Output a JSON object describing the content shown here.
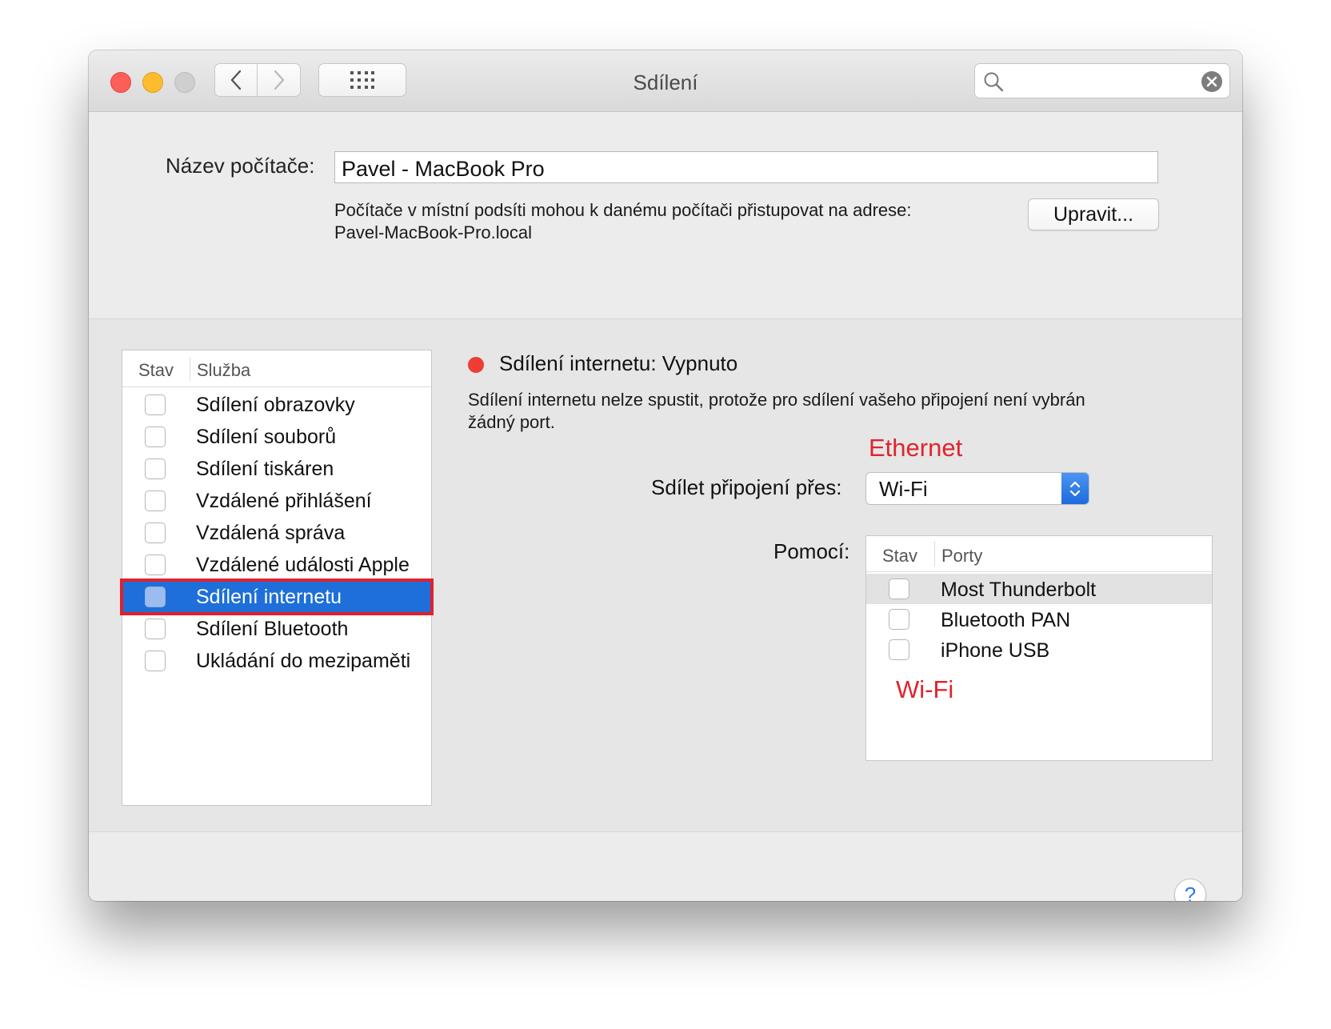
{
  "window": {
    "title": "Sdílení"
  },
  "toolbar": {
    "back_icon": "chevron-left-icon",
    "forward_icon": "chevron-right-icon",
    "grid_icon": "grid-icon"
  },
  "search": {
    "value": "",
    "placeholder": ""
  },
  "computer_name": {
    "label": "Název počítače:",
    "value": "Pavel - MacBook Pro",
    "address_line1": "Počítače v místní podsíti mohou k danému počítači přistupovat na adrese:",
    "address_line2": "Pavel-MacBook-Pro.local",
    "edit_button": "Upravit..."
  },
  "services": {
    "header_status": "Stav",
    "header_service": "Služba",
    "items": [
      {
        "label": "Sdílení obrazovky",
        "checked": false
      },
      {
        "label": "Sdílení souborů",
        "checked": false
      },
      {
        "label": "Sdílení tiskáren",
        "checked": false
      },
      {
        "label": "Vzdálené přihlášení",
        "checked": false
      },
      {
        "label": "Vzdálená správa",
        "checked": false
      },
      {
        "label": "Vzdálené události Apple",
        "checked": false
      },
      {
        "label": "Sdílení internetu",
        "checked": false,
        "selected": true
      },
      {
        "label": "Sdílení Bluetooth",
        "checked": false
      },
      {
        "label": "Ukládání do mezipaměti",
        "checked": false
      }
    ]
  },
  "detail": {
    "status_title": "Sdílení internetu: Vypnuto",
    "status_color": "#ef3d35",
    "description_line1": "Sdílení internetu nelze spustit, protože pro sdílení vašeho připojení není vybrán",
    "description_line2": "žádný port.",
    "annotation_top": "Ethernet",
    "share_via_label": "Sdílet připojení přes:",
    "share_via_value": "Wi-Fi",
    "using_label": "Pomocí:",
    "ports_header_status": "Stav",
    "ports_header_ports": "Porty",
    "ports": [
      {
        "label": "Most Thunderbolt",
        "checked": false,
        "highlighted": true
      },
      {
        "label": "Bluetooth PAN",
        "checked": false
      },
      {
        "label": "iPhone USB",
        "checked": false
      }
    ],
    "annotation_bottom": "Wi-Fi"
  },
  "help_button": "?",
  "colors": {
    "selection": "#1e6fd9",
    "annotation": "#e0242c",
    "highlight_border": "#e0212b"
  }
}
